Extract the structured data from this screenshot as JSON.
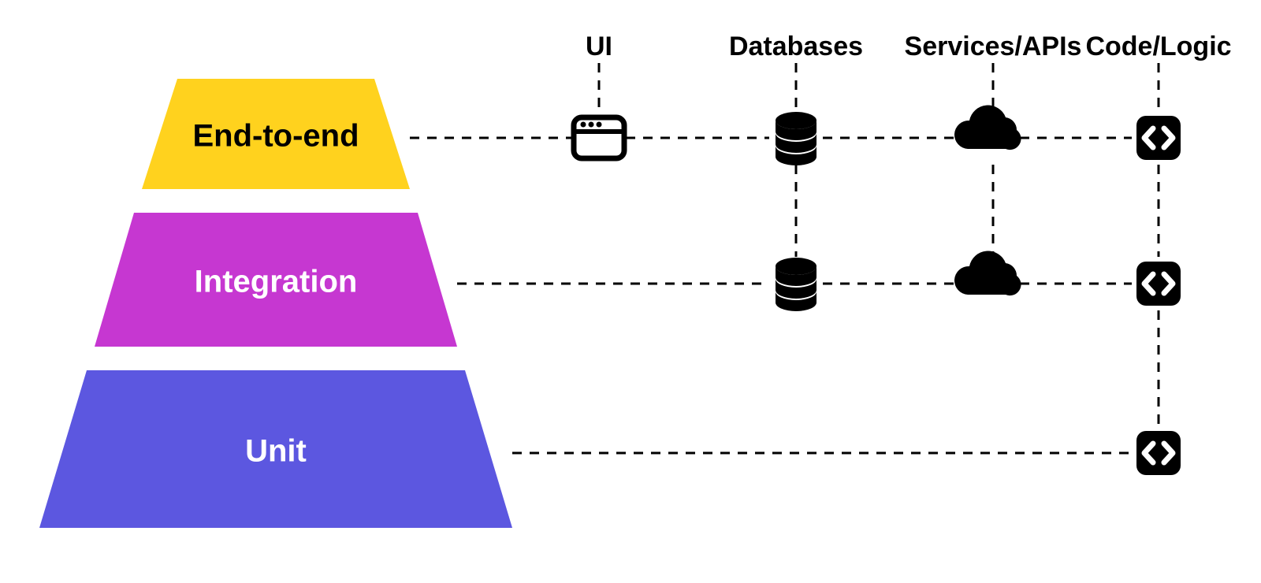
{
  "columns": {
    "ui": "UI",
    "db": "Databases",
    "svc": "Services/APIs",
    "code": "Code/Logic"
  },
  "levels": {
    "e2e": "End-to-end",
    "int": "Integration",
    "unit": "Unit"
  },
  "colors": {
    "e2e": "#FFD21E",
    "int": "#C637D1",
    "unit": "#5C57E0",
    "e2e_text": "#000000",
    "int_text": "#FFFFFF",
    "unit_text": "#FFFFFF"
  },
  "matrix": {
    "e2e": {
      "ui": true,
      "db": true,
      "svc": true,
      "code": true
    },
    "int": {
      "ui": false,
      "db": true,
      "svc": true,
      "code": true
    },
    "unit": {
      "ui": false,
      "db": false,
      "svc": false,
      "code": true
    }
  }
}
